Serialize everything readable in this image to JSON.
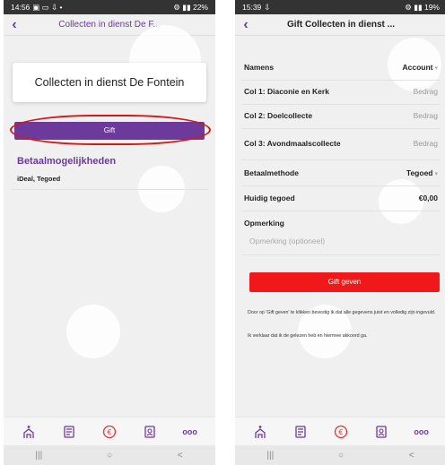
{
  "phone1": {
    "status": {
      "time": "14:56",
      "left_icons": "▣ ▭ ⇩ •",
      "right_icons": "⚙ ▮▮ 22%",
      "battery": ""
    },
    "title": "Collecten in dienst De F...",
    "card_title": "Collecten in dienst De Fontein",
    "gift_label": "Gift",
    "payment_title": "Betaalmogelijkheden",
    "payment_value": "iDeal, Tegoed"
  },
  "phone2": {
    "status": {
      "time": "15:39",
      "left_icons": "⇩",
      "right_icons": "⚙ ▮▮ 19%"
    },
    "title": "Gift Collecten in dienst ...",
    "rows": [
      {
        "label": "Namens",
        "value": "Account"
      },
      {
        "label": "Col 1: Diaconie en Kerk",
        "value": "Bedrag"
      },
      {
        "label": "Col 2: Doelcollecte",
        "value": "Bedrag"
      },
      {
        "label": "Col 3: Avondmaalscollecte",
        "value": "Bedrag"
      },
      {
        "label": "Betaalmethode",
        "value": "Tegoed"
      },
      {
        "label": "Huidig tegoed",
        "value": "€0,00"
      },
      {
        "label": "Opmerking",
        "value": ""
      }
    ],
    "remark_placeholder": "Opmerking (optioneel)",
    "submit_label": "Gift geven",
    "disclaimer_1": "Door op 'Gift geven' te klikken bevestig ik dat alle gegevens juist en volledig zijn ingevuld.",
    "disclaimer_2": "Ik verklaar dat ik de gelezen heb en hiermee akkoord ga."
  },
  "nav": {
    "items": [
      "church-icon",
      "bulletin-icon",
      "euro-icon",
      "contacts-icon",
      "more-icon"
    ],
    "more_label": "ooo",
    "accent": "#6b3a9a",
    "euro_color": "#e0343a"
  },
  "system_nav": {
    "recents": "|||",
    "home": "○",
    "back": "<"
  }
}
